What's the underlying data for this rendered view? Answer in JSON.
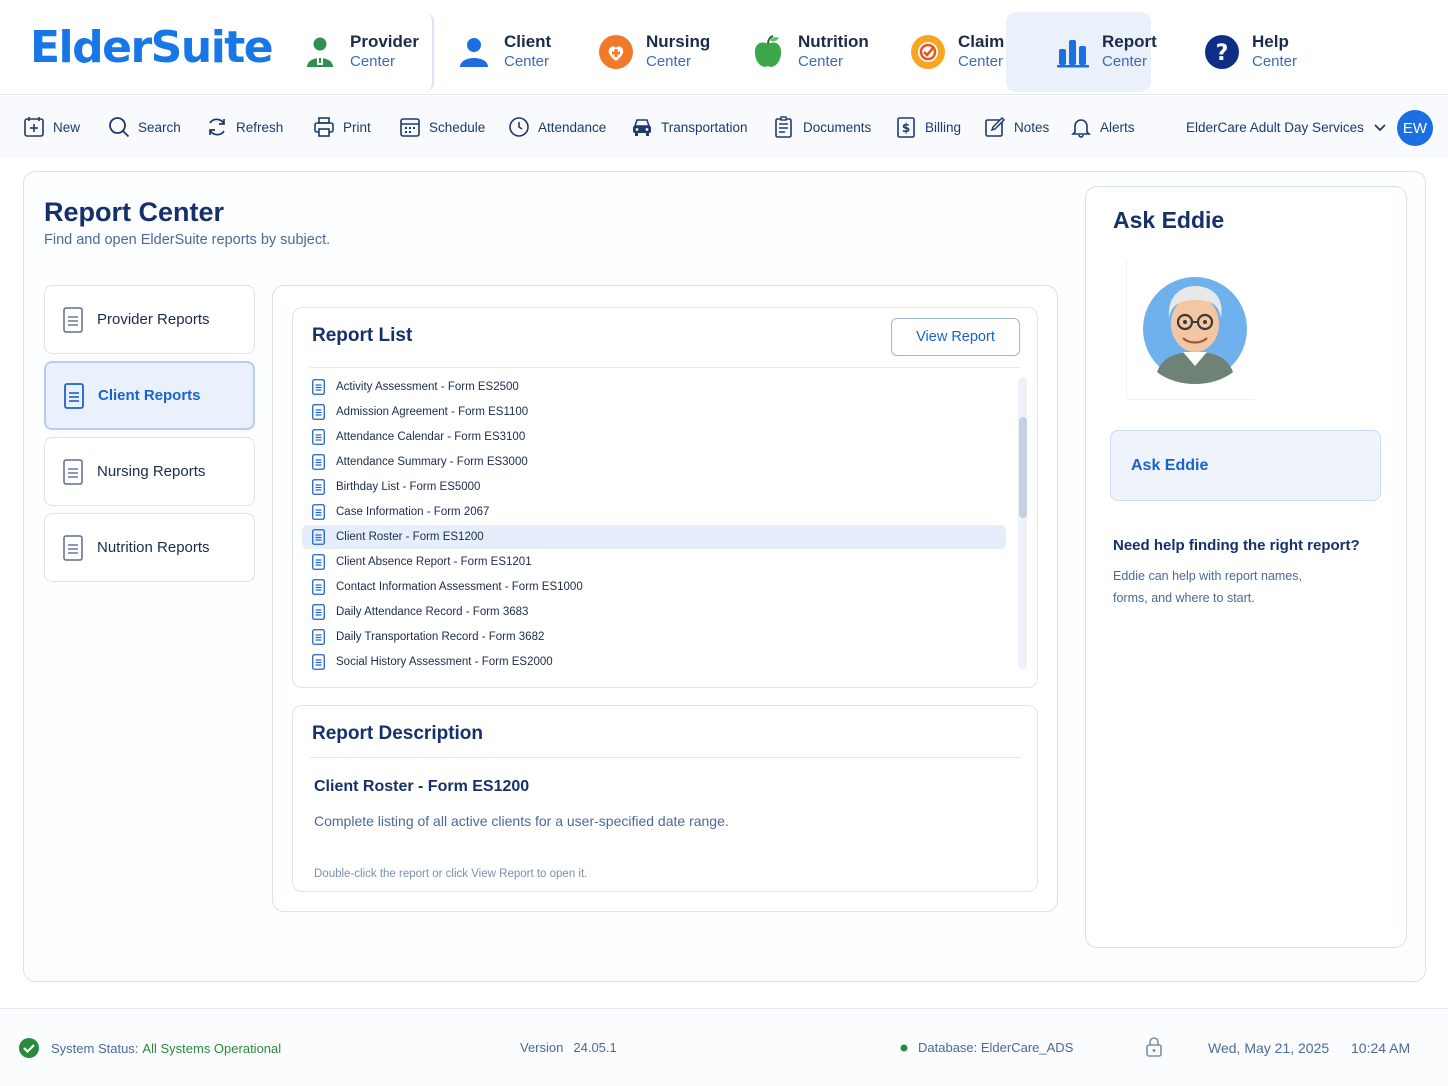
{
  "app": {
    "logo": "ElderSuite",
    "centers": [
      {
        "line1": "Provider",
        "line2": "Center"
      },
      {
        "line1": "Client",
        "line2": "Center"
      },
      {
        "line1": "Nursing",
        "line2": "Center"
      },
      {
        "line1": "Nutrition",
        "line2": "Center"
      },
      {
        "line1": "Claim",
        "line2": "Center"
      },
      {
        "line1": "Report",
        "line2": "Center"
      },
      {
        "line1": "Help",
        "line2": "Center"
      }
    ],
    "active_center": "Report Center"
  },
  "toolbar": {
    "items": [
      "New",
      "Search",
      "Refresh",
      "Print",
      "Schedule",
      "Attendance",
      "Transportation",
      "Documents",
      "Billing",
      "Notes",
      "Alerts"
    ],
    "org": "ElderCare Adult Day Services",
    "user_initials": "EW"
  },
  "page": {
    "title": "Report Center",
    "subtitle": "Find and open ElderSuite reports by subject."
  },
  "categories": [
    {
      "label": "Provider Reports",
      "selected": false
    },
    {
      "label": "Client Reports",
      "selected": true
    },
    {
      "label": "Nursing Reports",
      "selected": false
    },
    {
      "label": "Nutrition Reports",
      "selected": false
    }
  ],
  "report_list": {
    "title": "Report List",
    "view_button": "View Report",
    "items": [
      "Activity Assessment - Form ES2500",
      "Admission Agreement - Form ES1100",
      "Attendance Calendar - Form ES3100",
      "Attendance Summary - Form ES3000",
      "Birthday List - Form ES5000",
      "Case Information - Form 2067",
      "Client Roster - Form ES1200",
      "Client Absence Report - Form ES1201",
      "Contact Information Assessment - Form ES1000",
      "Daily Attendance Record - Form 3683",
      "Daily Transportation Record - Form 3682",
      "Social History Assessment - Form ES2000"
    ],
    "selected": "Client Roster - Form ES1200"
  },
  "description": {
    "title": "Report Description",
    "name": "Client Roster - Form ES1200",
    "text": "Complete listing of all active clients for a user-specified date range.",
    "hint": "Double-click the report or click View Report to open it."
  },
  "eddie": {
    "title": "Ask Eddie",
    "button": "Ask Eddie",
    "question": "Need help finding the right report?",
    "answer": "Eddie can help with report names, forms, and where to start."
  },
  "status": {
    "label": "System Status:",
    "value": "All Systems Operational",
    "version_label": "Version",
    "version": "24.05.1",
    "database": "Database: ElderCare_ADS",
    "date": "Wed, May 21, 2025",
    "time": "10:24 AM"
  },
  "colors": {
    "brand": "#1877e6",
    "accent": "#1b62cf",
    "ok": "#2a8a3e",
    "nursing": "#f07a2a",
    "nutrition": "#3aa74a",
    "claim": "#f5a623"
  }
}
